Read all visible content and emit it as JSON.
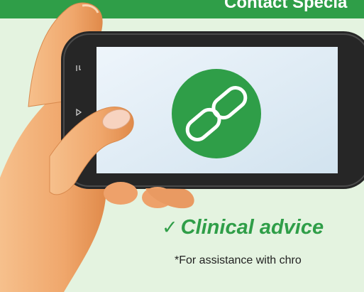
{
  "header": {
    "title": "Contact Specia"
  },
  "illustration": {
    "subject": "hand-holding-smartphone",
    "screen_icon": "link-chain-icon"
  },
  "feature": {
    "check_glyph": "✓",
    "label": "Clinical advice"
  },
  "footnote": {
    "text": "*For assistance with chro"
  },
  "colors": {
    "brand_green": "#2f9e48",
    "background": "#e4f3e0",
    "screen": "#dbe9f3",
    "phone_body": "#262626",
    "skin": "#f2b27c"
  }
}
